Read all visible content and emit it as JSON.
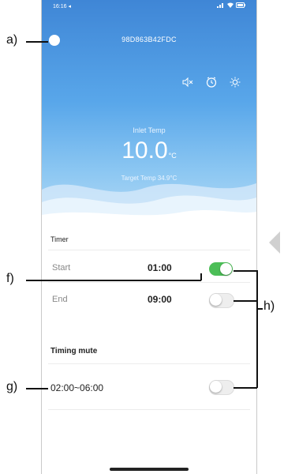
{
  "status_bar": {
    "time": "16:16 ◂"
  },
  "header": {
    "device_id": "98D863B42FDC"
  },
  "hero": {
    "inlet_label": "Inlet Temp",
    "temperature": "10.0",
    "unit": "°C",
    "target": "Target Temp  34.9°C"
  },
  "timer": {
    "title": "Timer",
    "start_label": "Start",
    "start_value": "01:00",
    "start_enabled": true,
    "end_label": "End",
    "end_value": "09:00",
    "end_enabled": false
  },
  "mute": {
    "title": "Timing mute",
    "range": "02:00~06:00",
    "enabled": false
  },
  "callouts": {
    "a": "a)",
    "f": "f)",
    "g": "g)",
    "h": "h)"
  },
  "colors": {
    "hero_top": "#3f86d6",
    "hero_bottom": "#b9dcf6",
    "toggle_on": "#4cbe57",
    "toggle_off": "#eeeeee"
  },
  "icons": [
    "back-icon",
    "mute-speaker-icon",
    "clock-icon",
    "brightness-icon",
    "signal-icon",
    "wifi-icon",
    "battery-icon"
  ]
}
